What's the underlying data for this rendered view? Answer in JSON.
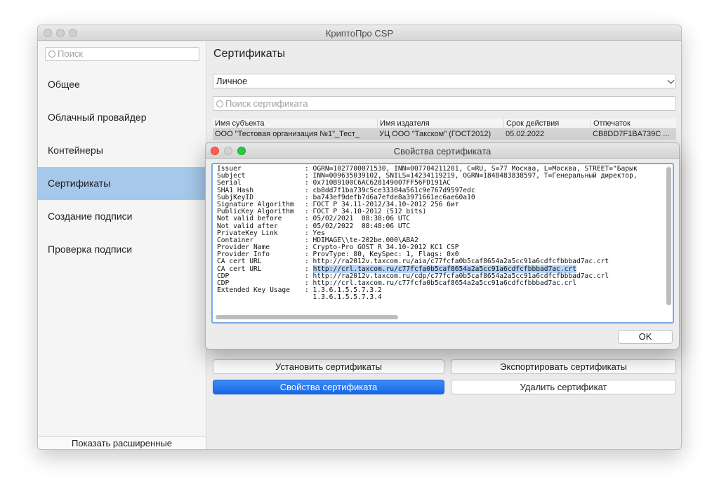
{
  "window": {
    "title": "КриптоПро CSP"
  },
  "sidebar": {
    "search_placeholder": "Поиск",
    "items": [
      {
        "label": "Общее"
      },
      {
        "label": "Облачный провайдер"
      },
      {
        "label": "Контейнеры"
      },
      {
        "label": "Сертификаты"
      },
      {
        "label": "Создание подписи"
      },
      {
        "label": "Проверка подписи"
      }
    ],
    "active_index": 3,
    "show_advanced": "Показать расширенные"
  },
  "main": {
    "title": "Сертификаты",
    "store_select": "Личное",
    "cert_search_placeholder": "Поиск сертификата",
    "table": {
      "headers": [
        "Имя субъекта",
        "Имя издателя",
        "Срок действия",
        "Отпечаток"
      ],
      "rows": [
        [
          "ООО \"Тестовая организация №1\"_Тест_",
          "УЦ ООО \"Такском\" (ГОСТ2012)",
          "05.02.2022",
          "CB8DD7F1BA739C ..."
        ]
      ]
    },
    "buttons": {
      "install": "Установить сертификаты",
      "export": "Экспортировать сертификаты",
      "properties": "Свойства сертификата",
      "delete": "Удалить сертификат"
    }
  },
  "dialog": {
    "title": "Свойства сертификата",
    "ok_label": "OK",
    "fields": [
      {
        "key": "Issuer",
        "value": ": OGRN=1027700071530, INN=007704211201, C=RU, S=77 Москва, L=Москва, STREET=\"Барык"
      },
      {
        "key": "Subject",
        "value": ": INN=009635039102, SNILS=14234119219, OGRN=1848483838597, T=Генеральный директор,"
      },
      {
        "key": "Serial",
        "value": ": 0x710B9100C6AC628149007FF56FD191AC"
      },
      {
        "key": "SHA1 Hash",
        "value": ": cb8dd7f1ba739c5ce33304a561c9e767d9597edc"
      },
      {
        "key": "SubjKeyID",
        "value": ": ba743ef9defb7d6a7efde8a3971661ec6ae60a10"
      },
      {
        "key": "Signature Algorithm",
        "value": ": ГОСТ Р 34.11-2012/34.10-2012 256 бит"
      },
      {
        "key": "PublicKey Algorithm",
        "value": ": ГОСТ Р 34.10-2012 (512 bits)"
      },
      {
        "key": "Not valid before",
        "value": ": 05/02/2021  08:38:06 UTC"
      },
      {
        "key": "Not valid after",
        "value": ": 05/02/2022  08:48:06 UTC"
      },
      {
        "key": "PrivateKey Link",
        "value": ": Yes"
      },
      {
        "key": "Container",
        "value": ": HDIMAGE\\\\te-202be.000\\ABA2"
      },
      {
        "key": "Provider Name",
        "value": ": Crypto-Pro GOST R 34.10-2012 KC1 CSP"
      },
      {
        "key": "Provider Info",
        "value": ": ProvType: 80, KeySpec: 1, Flags: 0x0"
      },
      {
        "key": "CA cert URL",
        "value": ": http://ra2012v.taxcom.ru/aia/c77fcfa0b5caf8654a2a5cc91a6cdfcfbbbad7ac.crt"
      },
      {
        "key": "CA cert URL",
        "value": ": ",
        "highlight": "http://crl.taxcom.ru/c77fcfa0b5caf8654a2a5cc91a6cdfcfbbbad7ac.crt"
      },
      {
        "key": "CDP",
        "value": ": http://ra2012v.taxcom.ru/cdp/c77fcfa0b5caf8654a2a5cc91a6cdfcfbbbad7ac.crl"
      },
      {
        "key": "CDP",
        "value": ": http://crl.taxcom.ru/c77fcfa0b5caf8654a2a5cc91a6cdfcfbbbad7ac.crl"
      },
      {
        "key": "Extended Key Usage",
        "value": ": 1.3.6.1.5.5.7.3.2"
      },
      {
        "key": "",
        "value": "  1.3.6.1.5.5.7.3.4"
      }
    ]
  }
}
